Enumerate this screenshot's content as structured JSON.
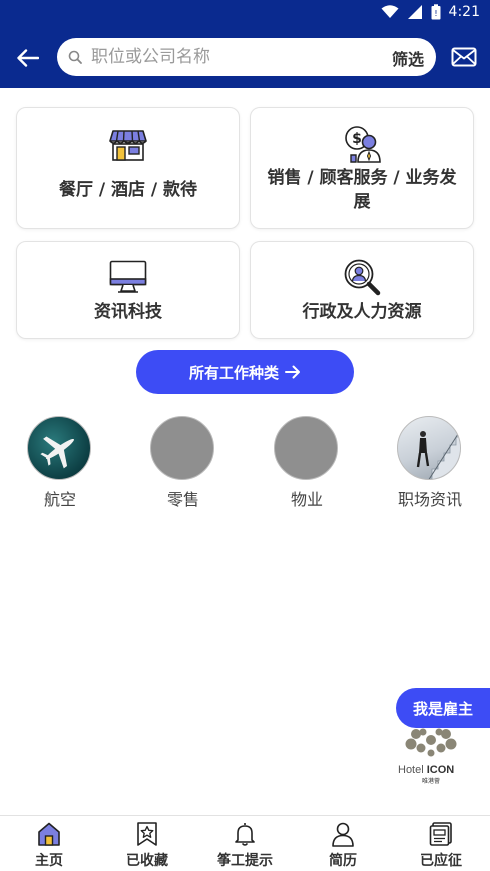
{
  "status_bar": {
    "time": "4:21"
  },
  "header": {
    "search_placeholder": "职位或公司名称",
    "filter_label": "筛选"
  },
  "job_categories": [
    {
      "label": "餐厅 / 酒店 / 款待",
      "icon": "store-icon"
    },
    {
      "label": "销售 / 顾客服务 / 业务发展",
      "icon": "sales-person-icon"
    },
    {
      "label": "资讯科技",
      "icon": "monitor-icon"
    },
    {
      "label": "行政及人力资源",
      "icon": "magnifier-person-icon"
    }
  ],
  "all_jobs_button": {
    "label": "所有工作种类",
    "icon": "arrow-right-icon"
  },
  "topics": [
    {
      "label": "航空",
      "icon": "airplane-image"
    },
    {
      "label": "零售",
      "icon": "placeholder-image"
    },
    {
      "label": "物业",
      "icon": "placeholder-image"
    },
    {
      "label": "职场资讯",
      "icon": "staircase-photo"
    }
  ],
  "employer_button": {
    "label": "我是雇主"
  },
  "ad_logo": {
    "brand": "Hotel ICON",
    "sub": "唯港薈"
  },
  "bottom_nav": [
    {
      "label": "主页",
      "icon": "home-icon",
      "active": true
    },
    {
      "label": "已收藏",
      "icon": "bookmark-star-icon",
      "active": false
    },
    {
      "label": "筝工提示",
      "icon": "bell-icon",
      "active": false
    },
    {
      "label": "简历",
      "icon": "profile-icon",
      "active": false
    },
    {
      "label": "已应征",
      "icon": "applied-icon",
      "active": false
    }
  ],
  "colors": {
    "header_bg": "#0a2a8f",
    "accent": "#3d4cf5",
    "icon_purple": "#7b7fe0"
  }
}
